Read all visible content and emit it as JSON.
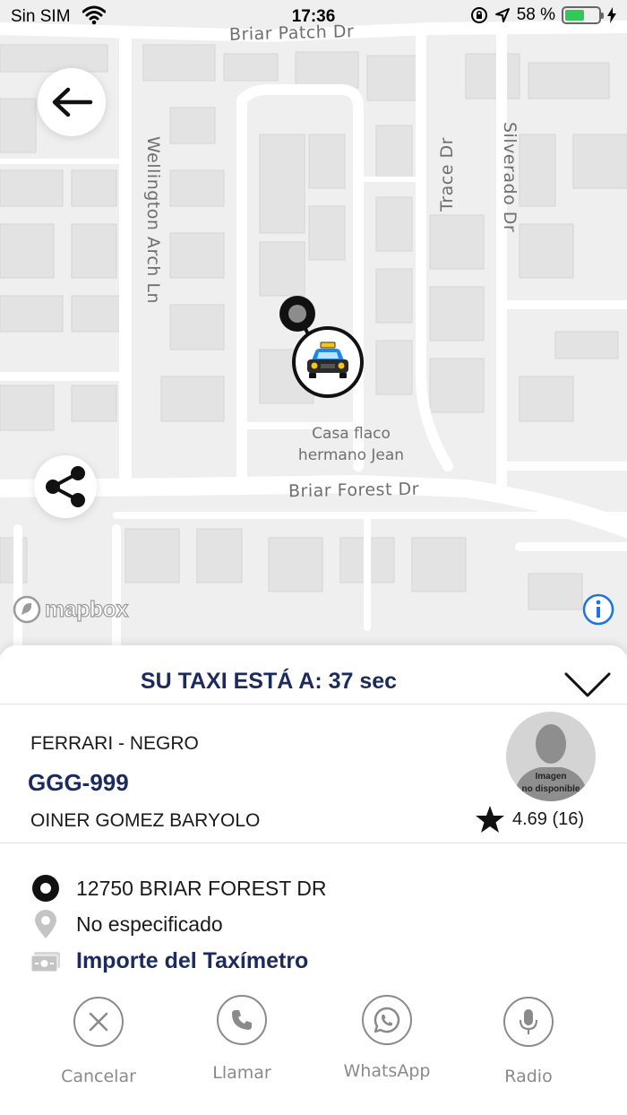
{
  "status_bar": {
    "carrier": "Sin SIM",
    "time": "17:36",
    "battery": "58 %",
    "battery_level": 0.58
  },
  "map": {
    "streets": {
      "briar_patch": "Briar Patch Dr",
      "wellington": "Wellington Arch Ln",
      "trace": "Trace Dr",
      "silverado": "Silverado Dr",
      "briar_forest": "Briar Forest Dr"
    },
    "poi": {
      "line1": "Casa flaco",
      "line2": "hermano Jean"
    },
    "attribution": "mapbox",
    "icons": {
      "back": "arrow-left-icon",
      "share": "share-icon",
      "info": "info-icon",
      "pickup": "pickup-pin-icon",
      "taxi": "taxi-car-icon"
    }
  },
  "trip_panel": {
    "eta_text": "SU TAXI ESTÁ A: 37 sec",
    "vehicle": "FERRARI - NEGRO",
    "plate": "GGG-999",
    "driver_name": "OINER GOMEZ BARYOLO",
    "photo_placeholder": {
      "line1": "Imagen",
      "line2": "no disponible"
    },
    "rating": "4.69 (16)",
    "pickup_address": "12750 BRIAR FOREST DR",
    "destination": "No especificado",
    "fare_link": "Importe del Taxímetro"
  },
  "actions": [
    {
      "label": "Cancelar",
      "icon": "close-icon"
    },
    {
      "label": "Llamar",
      "icon": "phone-icon"
    },
    {
      "label": "WhatsApp",
      "icon": "whatsapp-icon"
    },
    {
      "label": "Radio",
      "icon": "microphone-icon"
    }
  ],
  "colors": {
    "brand_navy": "#1c2b5e",
    "map_background": "#efefef",
    "battery_green": "#34c759"
  }
}
